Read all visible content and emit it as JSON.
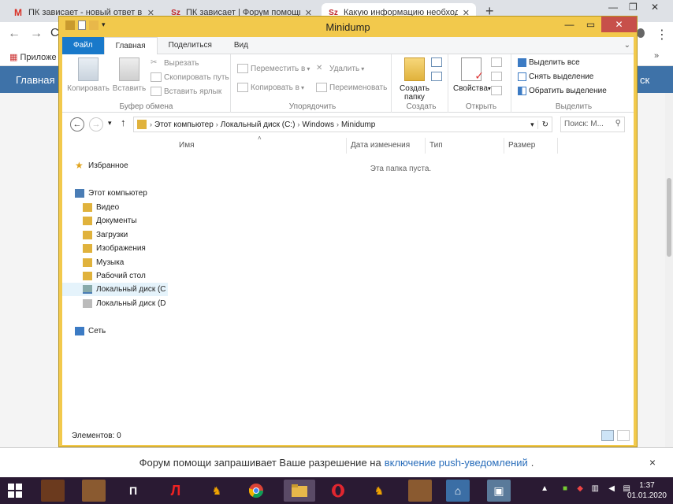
{
  "browser": {
    "tabs": [
      {
        "favicon": "M",
        "title": "ПК зависает - новый ответ в отв"
      },
      {
        "favicon": "Sz",
        "title": "ПК зависает | Форум помощи"
      },
      {
        "favicon": "Sz",
        "title": "Какую информацию необходи"
      }
    ],
    "new_tab": "+",
    "bookmarks_label": "Приложе",
    "site_nav_left": "Главная",
    "site_nav_right": "ск",
    "address_fragment": "С"
  },
  "notification": {
    "text_before": "Форум помощи запрашивает Ваше разрешение на",
    "link": "включение push-уведомлений",
    "text_after": ".",
    "close": "×"
  },
  "taskbar": {
    "clock_time": "1:37",
    "clock_date": "01.01.2020"
  },
  "explorer": {
    "title": "Minidump",
    "ribbon_tabs": [
      {
        "label": "Файл"
      },
      {
        "label": "Главная"
      },
      {
        "label": "Поделиться"
      },
      {
        "label": "Вид"
      }
    ],
    "groups": {
      "clipboard": {
        "name": "Буфер обмена",
        "copy": "Копировать",
        "paste": "Вставить",
        "cut": "Вырезать",
        "copy_path": "Скопировать путь",
        "paste_shortcut": "Вставить ярлык"
      },
      "organize": {
        "name": "Упорядочить",
        "move_to": "Переместить в",
        "copy_to": "Копировать в",
        "delete": "Удалить",
        "rename": "Переименовать"
      },
      "create": {
        "name": "Создать",
        "new_folder_line1": "Создать",
        "new_folder_line2": "папку"
      },
      "open": {
        "name": "Открыть",
        "properties": "Свойства"
      },
      "select": {
        "name": "Выделить",
        "select_all": "Выделить все",
        "select_none": "Снять выделение",
        "invert": "Обратить выделение"
      }
    },
    "address": {
      "crumbs": [
        "Этот компьютер",
        "Локальный диск (C:)",
        "Windows",
        "Minidump"
      ]
    },
    "search_placeholder": "Поиск: М...",
    "nav": {
      "favorites": "Избранное",
      "this_pc": "Этот компьютер",
      "items": [
        "Видео",
        "Документы",
        "Загрузки",
        "Изображения",
        "Музыка",
        "Рабочий стол",
        "Локальный диск (C",
        "Локальный диск (D"
      ],
      "network": "Сеть"
    },
    "columns": {
      "name": "Имя",
      "date": "Дата изменения",
      "type": "Тип",
      "size": "Размер"
    },
    "empty_text": "Эта папка пуста.",
    "status": "Элементов: 0",
    "colors": {
      "title_bar": "#f2c94c",
      "file_tab": "#1979ca",
      "close_button": "#c7504a",
      "nav_selected": "#e5f3fb"
    }
  }
}
